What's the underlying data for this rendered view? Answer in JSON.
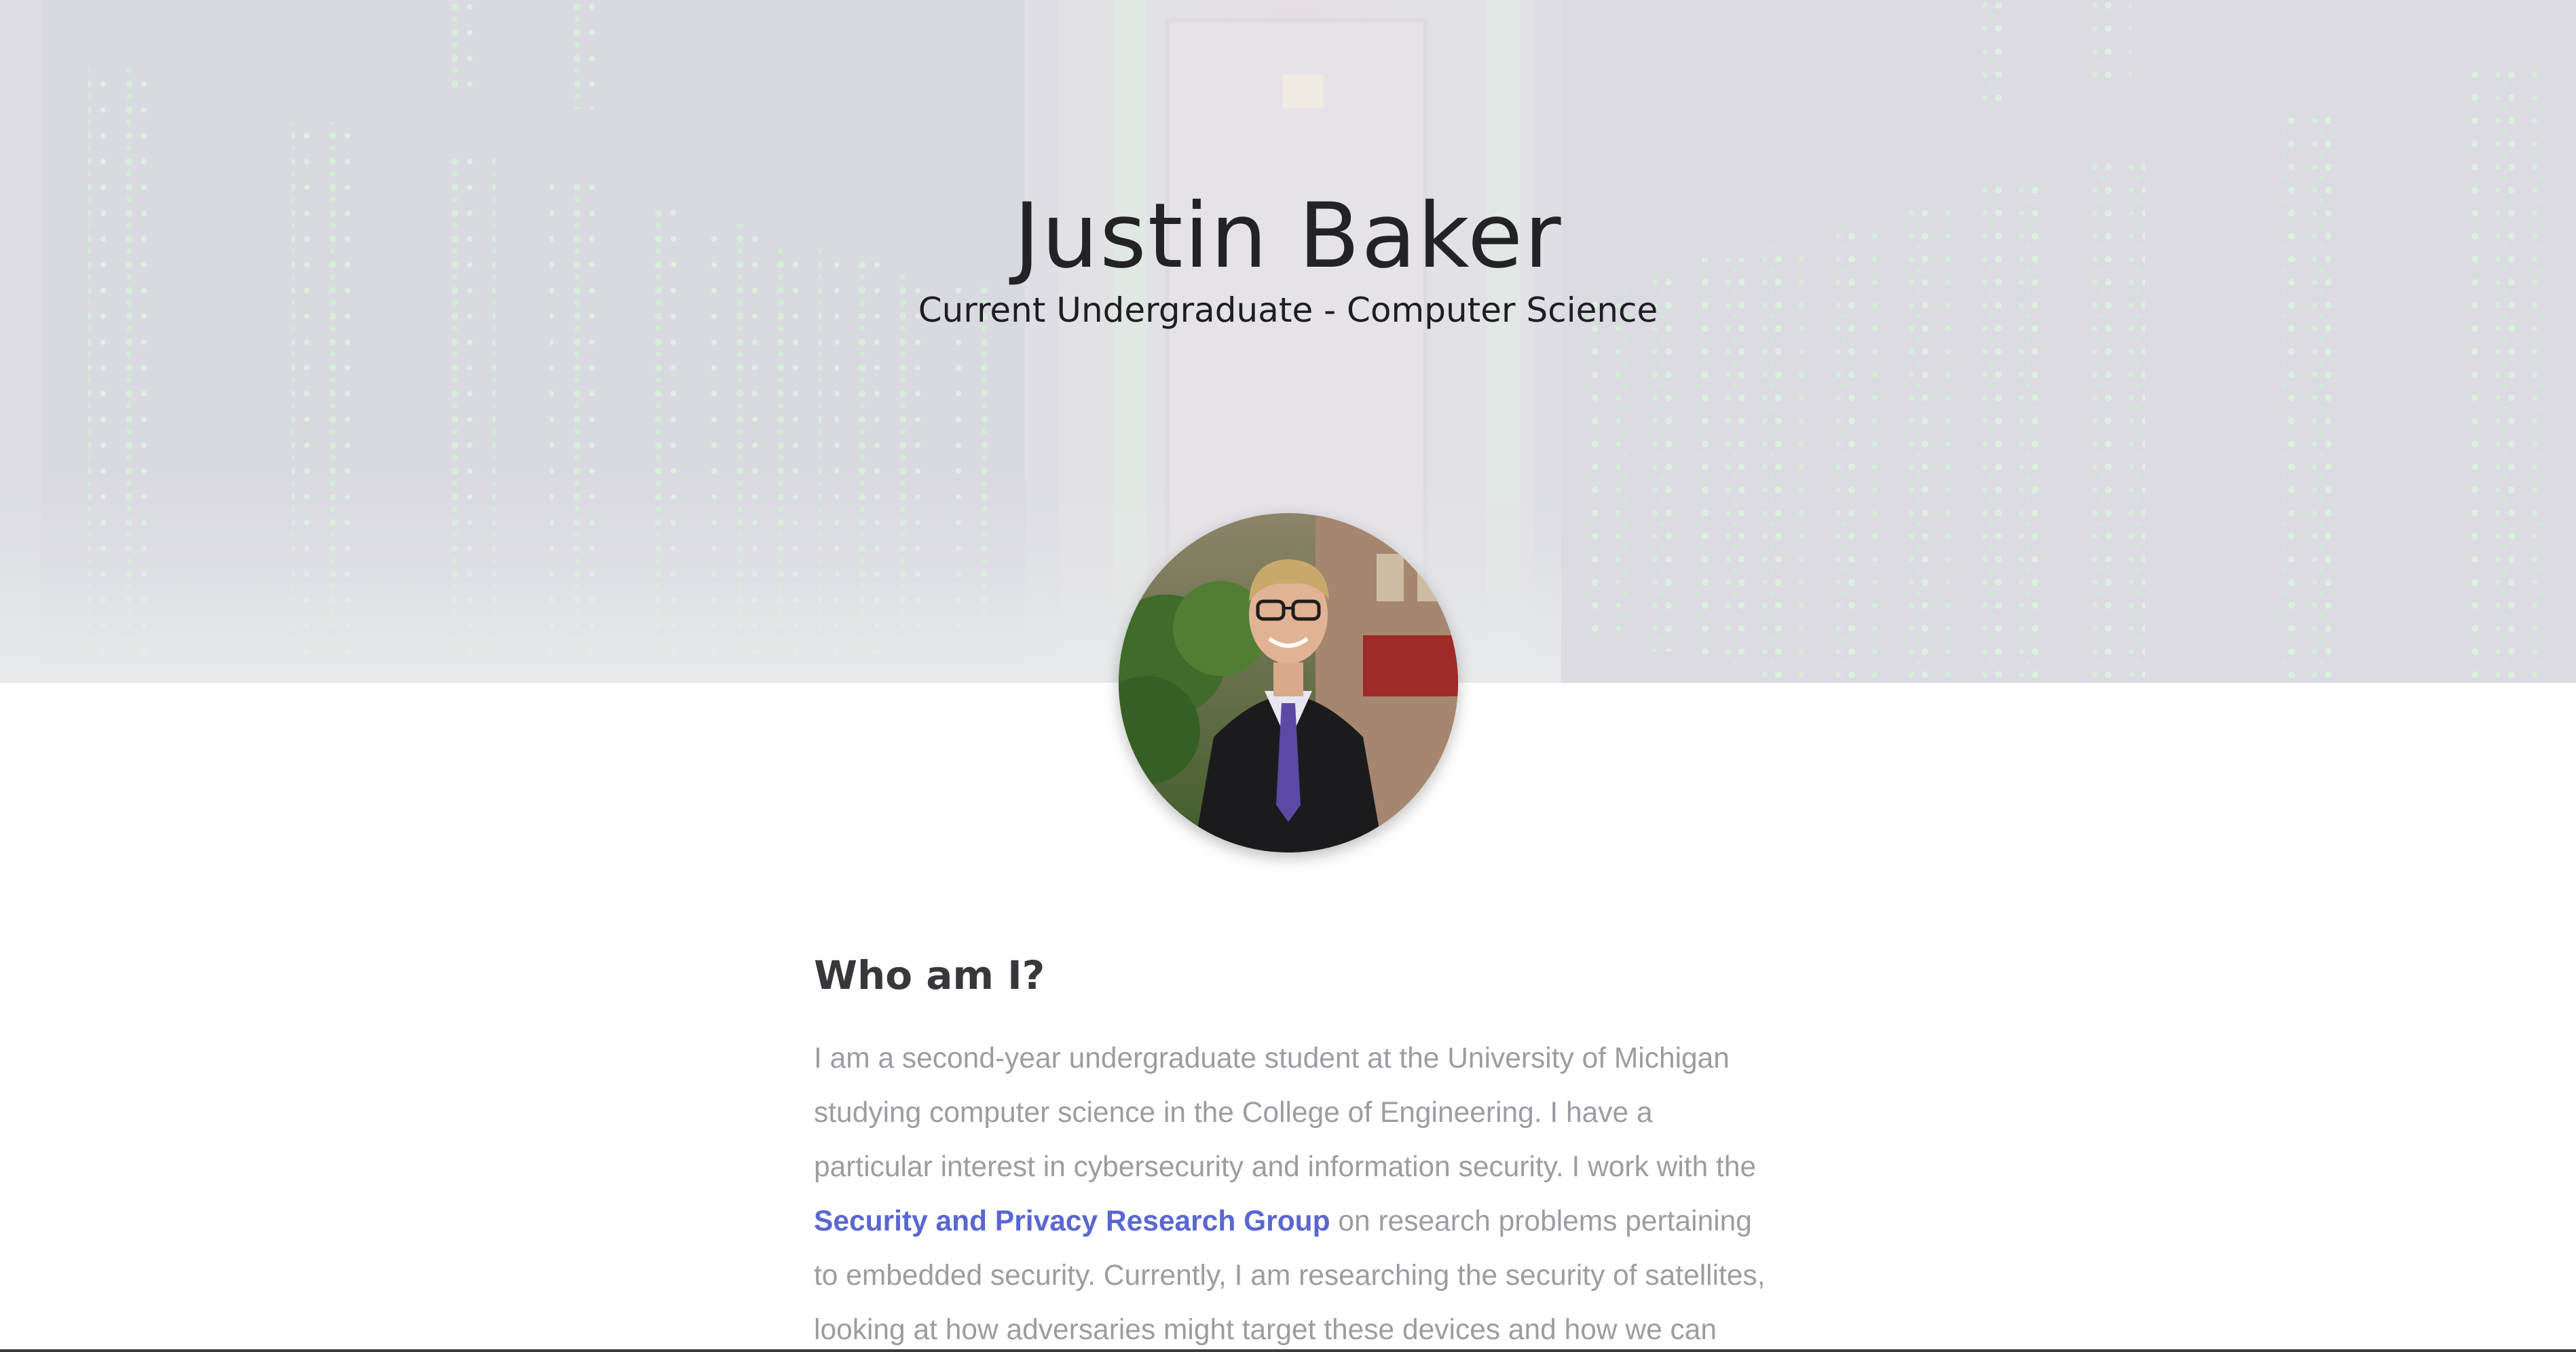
{
  "header": {
    "name": "Justin Baker",
    "subtitle": "Current Undergraduate - Computer Science"
  },
  "about": {
    "heading": "Who am I?",
    "bio_part1": "I am a second-year undergraduate student at the University of Michigan studying computer science in the College of Engineering. I have a particular interest in cybersecurity and information security. I work with the ",
    "bio_link": "Security and Privacy Research Group",
    "bio_part2": " on research problems pertaining to embedded security. Currently, I am researching the security of satellites, looking at how adversaries might target these devices and how we can prevent future"
  },
  "colors": {
    "link": "#5a67d0",
    "body_text": "#9c9ca3",
    "heading": "#37383c",
    "hero_text": "#232325"
  },
  "icons": {
    "hero_background": "server-room-background",
    "avatar": "profile-photo"
  }
}
